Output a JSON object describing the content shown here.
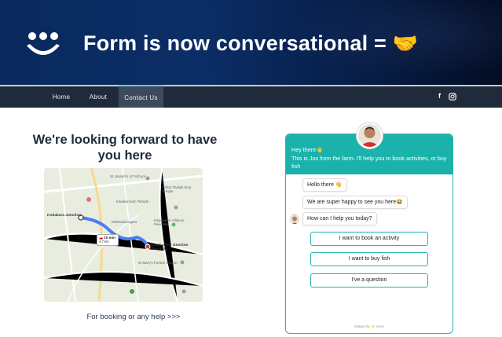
{
  "banner": {
    "title": "Form is now conversational =",
    "emoji": "🤝",
    "logo_icon": "smiley-logo-icon"
  },
  "nav": {
    "items": [
      {
        "label": "Home"
      },
      {
        "label": "About"
      },
      {
        "label": "Contact Us",
        "active": true
      }
    ],
    "social": [
      "facebook-icon",
      "instagram-icon"
    ]
  },
  "main": {
    "heading": "We're looking forward to have you here",
    "booking_text": "For booking or any help >>>",
    "map": {
      "origin": "Kodakara Junction",
      "destination": "Karakurissi Junction Bus Stop",
      "duration": "10 min",
      "distance": "4.7 km",
      "labels": [
        "St.Joseph's LP School",
        "Arthat Thaliyil Siva Temple",
        "Karakunnam Temple",
        "Muthukulangara",
        "Kaippuram Alliance Peedhika",
        "St Mary's Forane Church"
      ]
    }
  },
  "chat": {
    "greeting_line1": "Hey there👋",
    "greeting_line2": "This is Jos from the farm. I'll help you to book activities, or buy fish",
    "messages": [
      "Hello there 👋",
      "We are super happy to see you here😄",
      "How can I help you today?"
    ],
    "options": [
      "I want to book an activity",
      "I want to buy fish",
      "I've a question"
    ],
    "footer": "Widget by ⚡ Hiver",
    "accent": "#1ab2aa"
  }
}
